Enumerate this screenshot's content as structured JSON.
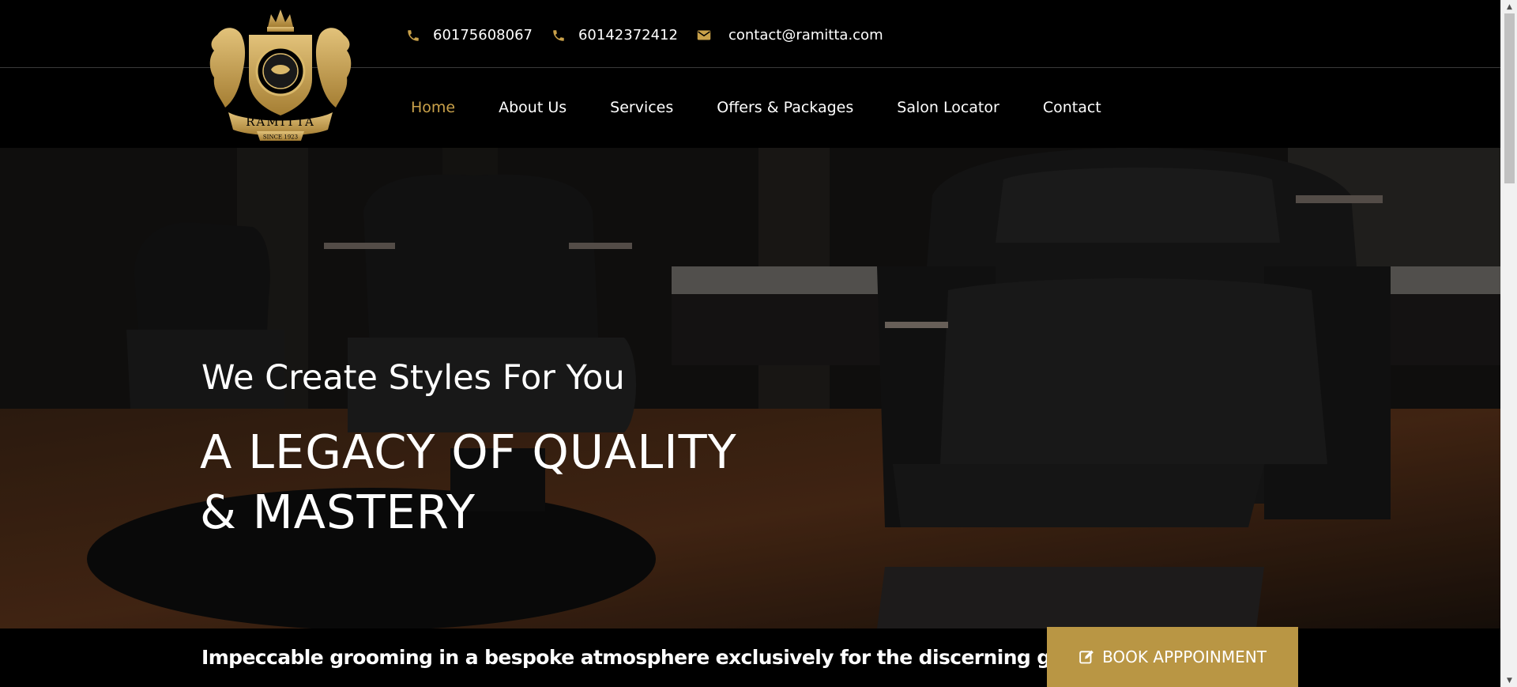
{
  "brand": {
    "logo_icon": "ramitta-crest-logo",
    "name": "RAMITTA",
    "since": "SINCE 1923",
    "gold": "#c9a14a"
  },
  "contact": {
    "phone1": "60175608067",
    "phone2": "60142372412",
    "email": "contact@ramitta.com",
    "phone_icon": "phone-icon",
    "email_icon": "envelope-icon"
  },
  "nav": {
    "items": [
      {
        "label": "Home",
        "active": true
      },
      {
        "label": "About Us"
      },
      {
        "label": "Services"
      },
      {
        "label": "Offers & Packages"
      },
      {
        "label": "Salon Locator"
      },
      {
        "label": "Contact"
      }
    ]
  },
  "hero": {
    "tagline": "We Create Styles For You",
    "headline": "A LEGACY OF QUALITY & MASTERY",
    "background": "barber-chairs-photo"
  },
  "strip": {
    "text": "Impeccable grooming in a bespoke atmosphere exclusively for the discerning gentlemen.",
    "book_label": "BOOK APPPOINMENT",
    "book_icon": "edit-icon",
    "button_color": "#b99644"
  }
}
